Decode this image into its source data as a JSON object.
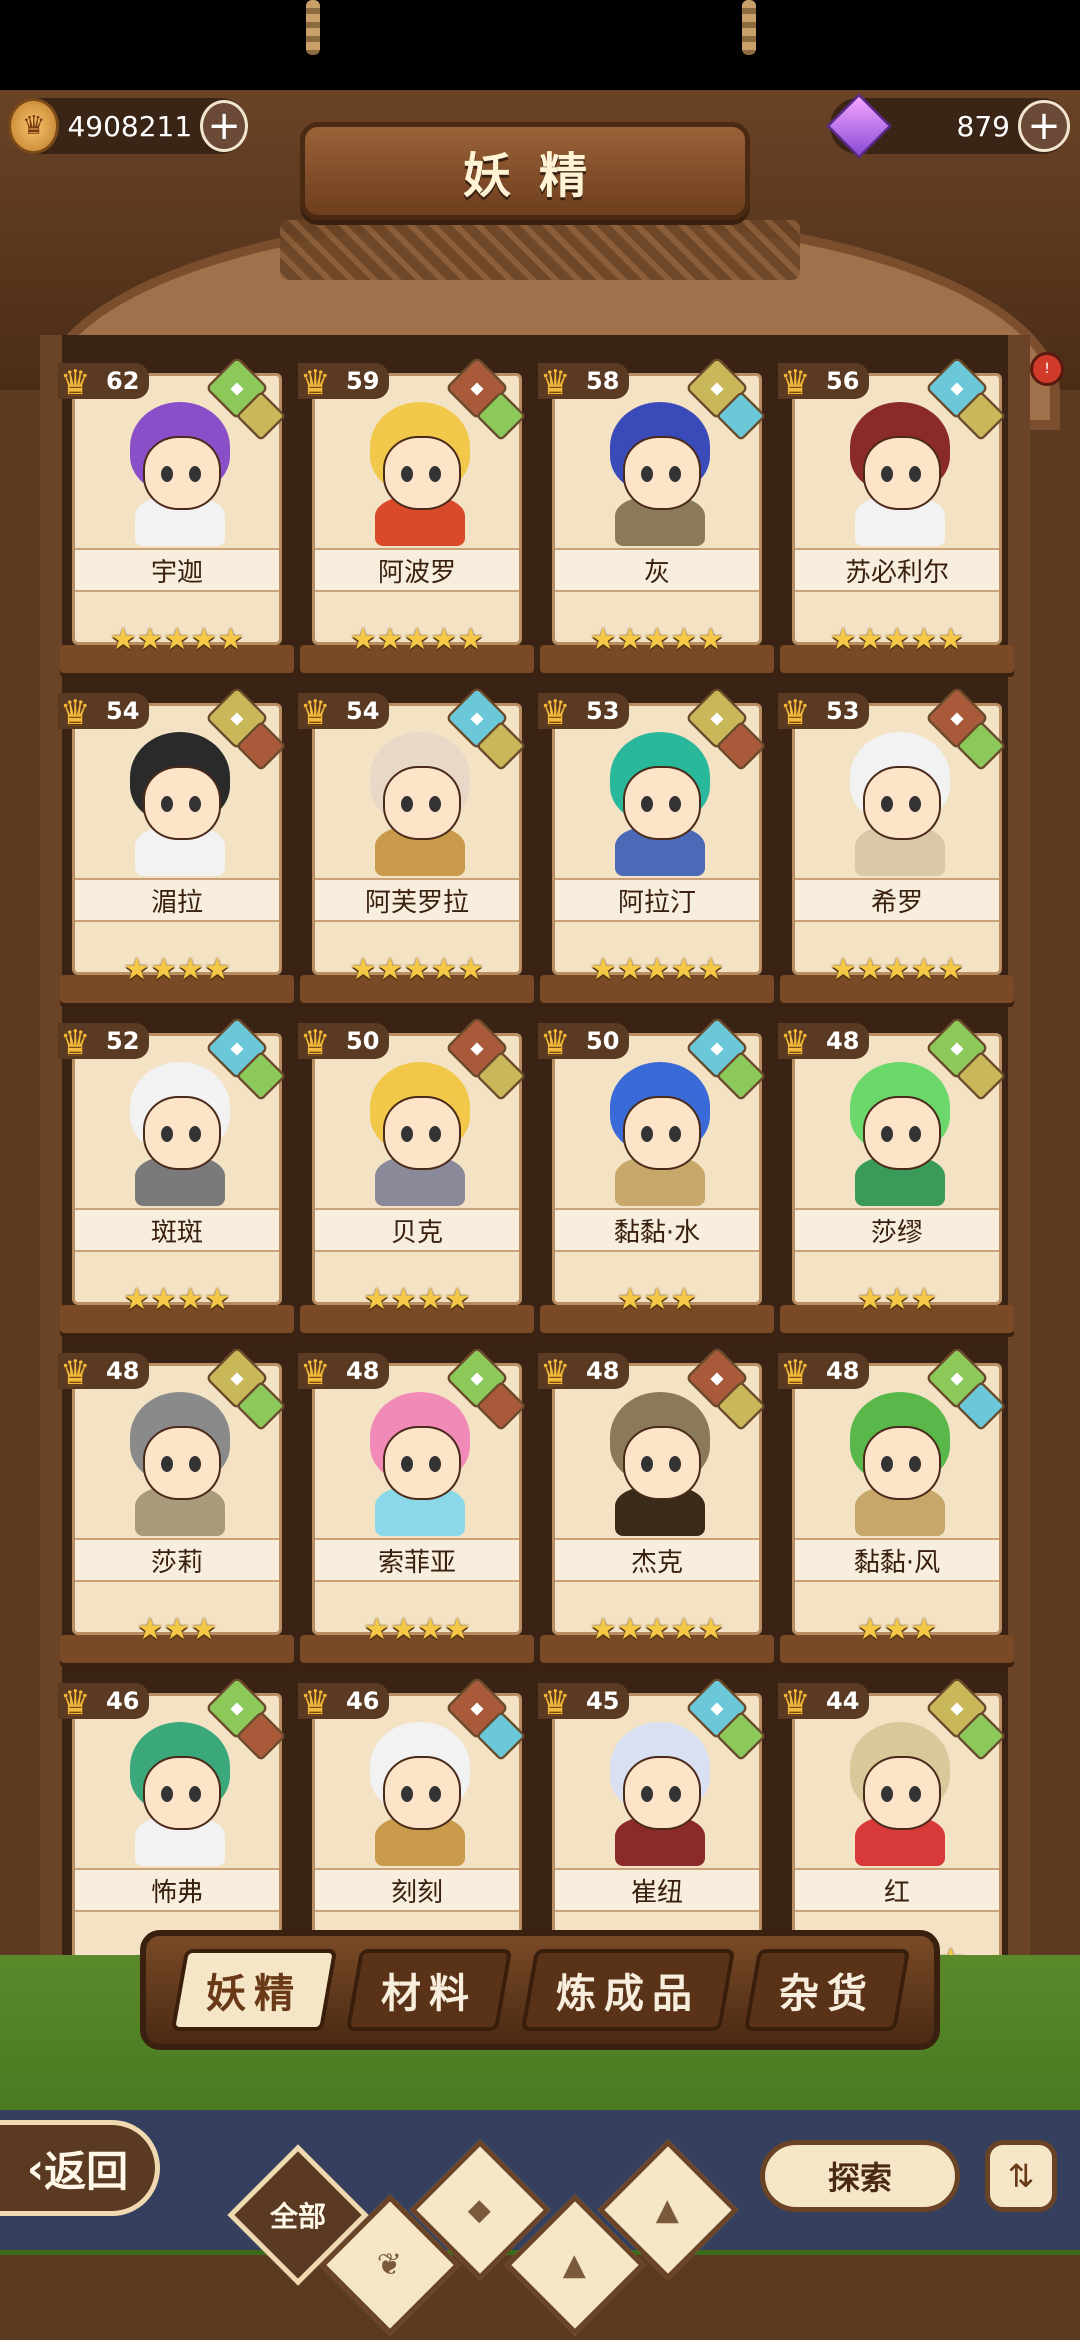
{
  "header": {
    "title": "妖精",
    "coins": "4908211",
    "gems": "879",
    "coin_icon": "coin-icon",
    "gem_icon": "gem-icon",
    "plus_symbol": "+"
  },
  "fairies": [
    {
      "name": "宇迦",
      "level": "62",
      "stars": "★★★★★",
      "hair": "#8a4fc8",
      "cloth": "#f2f2f2",
      "elem": "#8cc85a",
      "elem2": "#c8b85a"
    },
    {
      "name": "阿波罗",
      "level": "59",
      "stars": "★★★★★",
      "hair": "#f2c84a",
      "cloth": "#d84a2a",
      "elem": "#a85a3a",
      "elem2": "#8cc85a"
    },
    {
      "name": "灰",
      "level": "58",
      "stars": "★★★★★",
      "hair": "#3a4ab8",
      "cloth": "#8a7a5a",
      "elem": "#c8b85a",
      "elem2": "#6ac8d8"
    },
    {
      "name": "苏必利尔",
      "level": "56",
      "stars": "★★★★★",
      "hair": "#8a2a2a",
      "cloth": "#f2f2f2",
      "elem": "#6ac8d8",
      "elem2": "#c8b85a"
    },
    {
      "name": "湄拉",
      "level": "54",
      "stars": "★★★★",
      "hair": "#2a2a2a",
      "cloth": "#f2f2f2",
      "elem": "#c8b85a",
      "elem2": "#a85a3a"
    },
    {
      "name": "阿芙罗拉",
      "level": "54",
      "stars": "★★★★★",
      "hair": "#e8d8c8",
      "cloth": "#c89a4a",
      "elem": "#6ac8d8",
      "elem2": "#c8b85a"
    },
    {
      "name": "阿拉汀",
      "level": "53",
      "stars": "★★★★★",
      "hair": "#2ab89a",
      "cloth": "#4a6ab8",
      "elem": "#c8b85a",
      "elem2": "#a85a3a"
    },
    {
      "name": "希罗",
      "level": "53",
      "stars": "★★★★★",
      "hair": "#f2f2f2",
      "cloth": "#d8c8a8",
      "elem": "#a85a3a",
      "elem2": "#8cc85a"
    },
    {
      "name": "斑斑",
      "level": "52",
      "stars": "★★★★",
      "hair": "#f2f2f2",
      "cloth": "#7a7a7a",
      "elem": "#6ac8d8",
      "elem2": "#8cc85a"
    },
    {
      "name": "贝克",
      "level": "50",
      "stars": "★★★★",
      "hair": "#f2c84a",
      "cloth": "#8a8a9a",
      "elem": "#a85a3a",
      "elem2": "#c8b85a"
    },
    {
      "name": "黏黏·水",
      "level": "50",
      "stars": "★★★",
      "hair": "#3a6ad8",
      "cloth": "#c8a86a",
      "elem": "#6ac8d8",
      "elem2": "#8cc85a"
    },
    {
      "name": "莎缪",
      "level": "48",
      "stars": "★★★",
      "hair": "#6ad86a",
      "cloth": "#3a9a5a",
      "elem": "#8cc85a",
      "elem2": "#c8b85a"
    },
    {
      "name": "莎莉",
      "level": "48",
      "stars": "★★★",
      "hair": "#8a8a8a",
      "cloth": "#a89a7a",
      "elem": "#c8b85a",
      "elem2": "#8cc85a"
    },
    {
      "name": "索菲亚",
      "level": "48",
      "stars": "★★★★",
      "hair": "#f28ab8",
      "cloth": "#8ad8e8",
      "elem": "#8cc85a",
      "elem2": "#a85a3a"
    },
    {
      "name": "杰克",
      "level": "48",
      "stars": "★★★★★",
      "hair": "#8a7a5a",
      "cloth": "#3a2a1a",
      "elem": "#a85a3a",
      "elem2": "#c8b85a"
    },
    {
      "name": "黏黏·风",
      "level": "48",
      "stars": "★★★",
      "hair": "#5ab84a",
      "cloth": "#c8a86a",
      "elem": "#8cc85a",
      "elem2": "#6ac8d8"
    },
    {
      "name": "怖弗",
      "level": "46",
      "stars": "★★★",
      "hair": "#3aa87a",
      "cloth": "#f2f2f2",
      "elem": "#8cc85a",
      "elem2": "#a85a3a"
    },
    {
      "name": "刻刻",
      "level": "46",
      "stars": "★★★★★",
      "hair": "#f2f2f2",
      "cloth": "#c89a4a",
      "elem": "#a85a3a",
      "elem2": "#6ac8d8"
    },
    {
      "name": "崔纽",
      "level": "45",
      "stars": "★★★★",
      "hair": "#d8e0f2",
      "cloth": "#8a2a2a",
      "elem": "#6ac8d8",
      "elem2": "#8cc85a"
    },
    {
      "name": "红",
      "level": "44",
      "stars": "★★★★★",
      "hair": "#d8c89a",
      "cloth": "#d83a3a",
      "elem": "#c8b85a",
      "elem2": "#8cc85a"
    }
  ],
  "tabs": [
    "妖精",
    "材料",
    "炼成品",
    "杂货"
  ],
  "footer": {
    "back_label": "返回",
    "filter_all": "全部",
    "explore_label": "探索",
    "sort_icon": "sort-icon"
  }
}
